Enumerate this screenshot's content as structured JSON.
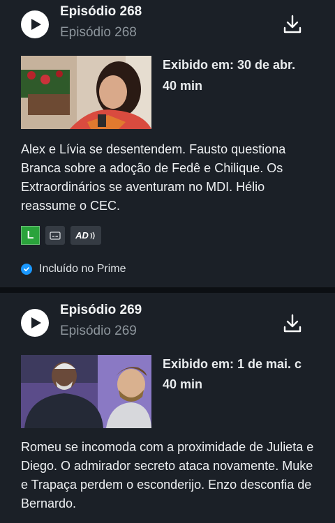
{
  "episodes": [
    {
      "title": "Episódio 268",
      "subtitle": "Episódio 268",
      "aired": "Exibido em: 30 de abr.",
      "duration": "40 min",
      "synopsis": "Alex e Lívia se desentendem. Fausto questiona Branca sobre a adoção de Fedê e Chilique. Os Extraordinários se aventuram no MDI. Hélio reassume o CEC.",
      "rating": "L",
      "ad_label": "AD",
      "included": "Incluído no Prime"
    },
    {
      "title": "Episódio 269",
      "subtitle": "Episódio 269",
      "aired": "Exibido em: 1 de mai. c",
      "duration": "40 min",
      "synopsis": "Romeu se incomoda com a proximidade de Julieta e Diego. O admirador secreto ataca novamente. Muke e Trapaça perdem o esconderijo. Enzo desconfia de Bernardo."
    }
  ],
  "colors": {
    "background": "#1b2027",
    "separator": "#0c0f13",
    "rating_green": "#2aa33b",
    "prime_blue": "#1a98ff",
    "subtitle_gray": "#8d959c"
  },
  "icons": [
    "play-icon",
    "download-icon",
    "subtitles-icon",
    "audio-description-icon",
    "check-icon"
  ]
}
